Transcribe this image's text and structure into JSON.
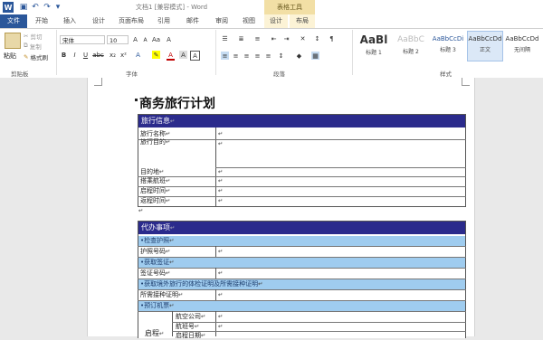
{
  "window": {
    "title": "文档1 [兼容模式] - Word",
    "context_tab_group": "表格工具"
  },
  "tabs": {
    "file": "文件",
    "items": [
      "开始",
      "插入",
      "设计",
      "页面布局",
      "引用",
      "邮件",
      "审阅",
      "视图",
      "设计",
      "布局"
    ]
  },
  "ribbon": {
    "clipboard": {
      "paste": "粘贴",
      "cut": "剪切",
      "copy": "复制",
      "format_painter": "格式刷",
      "group": "剪贴板"
    },
    "font": {
      "name": "宋体",
      "size": "10",
      "group": "字体"
    },
    "paragraph": {
      "group": "段落"
    },
    "styles": {
      "group": "样式",
      "items": [
        {
          "preview": "AaBl",
          "name": "标题 1"
        },
        {
          "preview": "AaBbC",
          "name": "标题 2"
        },
        {
          "preview": "AaBbCcDi",
          "name": "标题 3"
        },
        {
          "preview": "AaBbCcDd",
          "name": "正文"
        },
        {
          "preview": "AaBbCcDd",
          "name": "无间隔"
        }
      ]
    }
  },
  "document": {
    "heading": "商务旅行计划",
    "travel_info": {
      "header": "旅行信息",
      "rows": [
        {
          "label": "旅行名称"
        },
        {
          "label": "旅行目的"
        },
        {
          "label": "目的地"
        },
        {
          "label": "搭乘航班"
        },
        {
          "label": "启程时间"
        },
        {
          "label": "返程时间"
        }
      ]
    },
    "agenda": {
      "header": "代办事项",
      "rows": [
        {
          "type": "section",
          "label": "检查护照"
        },
        {
          "type": "field",
          "label": "护照号码"
        },
        {
          "type": "section",
          "label": "获取签证"
        },
        {
          "type": "field",
          "label": "签证号码"
        },
        {
          "type": "section",
          "label": "获取境外旅行的体检证明及所需接种证明"
        },
        {
          "type": "field",
          "label": "所需接种证明"
        },
        {
          "type": "section",
          "label": "预订机票"
        }
      ],
      "flight": {
        "group_label": "启程",
        "fields": [
          "航空公司",
          "航班号",
          "启程日期"
        ]
      }
    }
  }
}
